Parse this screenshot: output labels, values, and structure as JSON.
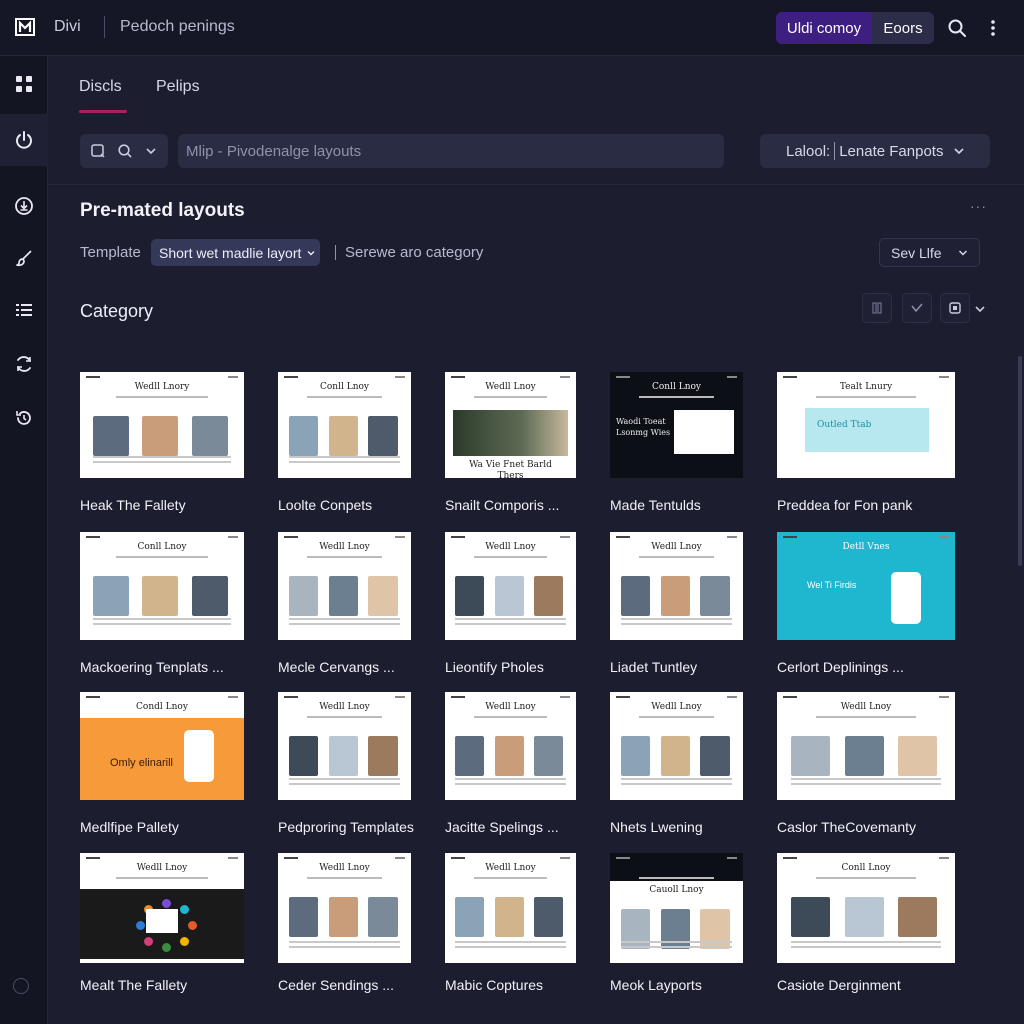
{
  "app": {
    "logo_text": "M",
    "name": "Divi",
    "breadcrumb": "Pedoch penings"
  },
  "header": {
    "primary_btn": "Uldi comoy",
    "secondary_btn": "Eoors"
  },
  "tabs": [
    {
      "label": "Discls"
    },
    {
      "label": "Pelips"
    }
  ],
  "search": {
    "placeholder": "Mlip - Pivodenalge layouts"
  },
  "label_filter": {
    "label": "Lalool:",
    "value": "Lenate Fanpots"
  },
  "section": {
    "title": "Pre-mated layouts",
    "more": "···"
  },
  "filters": {
    "template_label": "Template",
    "chip": "Short wet madlie layort",
    "category_hint": "Serewe aro category",
    "sort": "Sev Llfe"
  },
  "category": {
    "title": "Category"
  },
  "cards": [
    {
      "title": "Heak The Fallety",
      "heading": "Wedll Lnory",
      "theme": "photo"
    },
    {
      "title": "Loolte Conpets",
      "heading": "Conll Lnoy",
      "theme": "photo"
    },
    {
      "title": "Snailt Comporis ...",
      "heading": "Wedll Lnoy",
      "theme": "office",
      "banner": "Wa Vie Fnet Barld Thers"
    },
    {
      "title": "Made Tentulds",
      "heading": "Conll Lnoy",
      "theme": "dark",
      "banner": "Waodi Toeat Lsonmg Wies"
    },
    {
      "title": "Preddea for Fon pank",
      "heading": "Tealt Lnury",
      "theme": "cyan-light",
      "banner": "Outled Ttab"
    },
    {
      "title": "Mackoering Tenplats ...",
      "heading": "Conll Lnoy",
      "theme": "photo"
    },
    {
      "title": "Mecle Cervangs ...",
      "heading": "Wedll Lnoy",
      "theme": "photo"
    },
    {
      "title": "Lieontify Pholes",
      "heading": "Wedll Lnoy",
      "theme": "photo"
    },
    {
      "title": "Liadet Tuntley",
      "heading": "Wedll Lnoy",
      "theme": "photo"
    },
    {
      "title": "Cerlort Deplinings ...",
      "heading": "Detll Vnes",
      "theme": "cyan",
      "banner": "Wel Ti Firdis"
    },
    {
      "title": "Medlfipe Pallety",
      "heading": "Condl Lnoy",
      "theme": "orange",
      "banner": "Omly elinarill"
    },
    {
      "title": "Pedproring Templates",
      "heading": "Wedll Lnoy",
      "theme": "photo"
    },
    {
      "title": "Jacitte Spelings ...",
      "heading": "Wedll Lnoy",
      "theme": "photo"
    },
    {
      "title": "Nhets Lwening",
      "heading": "Wedll Lnoy",
      "theme": "photo"
    },
    {
      "title": "Caslor TheCovemanty",
      "heading": "Wedll Lnoy",
      "theme": "photo"
    },
    {
      "title": "Mealt The Fallety",
      "heading": "Wedll Lnoy",
      "theme": "dark-band"
    },
    {
      "title": "Ceder Sendings ...",
      "heading": "Wedll Lnoy",
      "theme": "photo"
    },
    {
      "title": "Mabic Coptures",
      "heading": "Wedll Lnoy",
      "theme": "photo"
    },
    {
      "title": "Meok Layports",
      "heading": "Cauoll Lnoy",
      "theme": "dark-top"
    },
    {
      "title": "Casiote Derginment",
      "heading": "Conll Lnoy",
      "theme": "photo"
    }
  ],
  "colors": {
    "accent": "#3d1f82",
    "tab_underline": "#a3255b",
    "cyan": "#1fb7cf",
    "orange": "#f79a3a"
  }
}
